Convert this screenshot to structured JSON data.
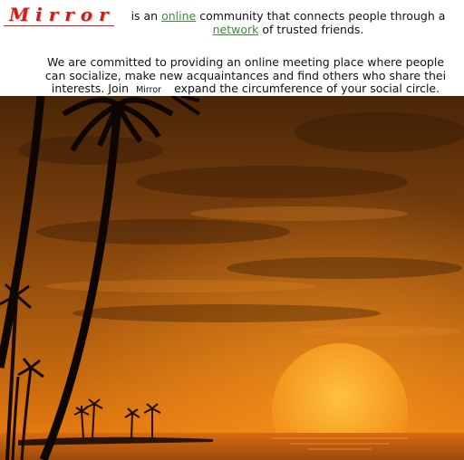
{
  "site": {
    "logo": "Mirror"
  },
  "intro": {
    "pre": "is an ",
    "link1": "online",
    "mid": " community that connects people through a",
    "link2": "network",
    "post": " of trusted friends."
  },
  "mission": {
    "line1": "We are committed to providing an online meeting place where people",
    "line2": "can socialize, make new acquaintances and find others who share thei",
    "line3_pre": "interests. Join",
    "line3_logo": "Mirror",
    "line3_post": "expand the circumference of your social circle."
  },
  "colors": {
    "logo": "#c8201a",
    "link": "#3f8a3a",
    "sky_top": "#4a2608",
    "sky_mid": "#b8620f",
    "horizon": "#e2780f",
    "sun": "#f7a21c"
  }
}
